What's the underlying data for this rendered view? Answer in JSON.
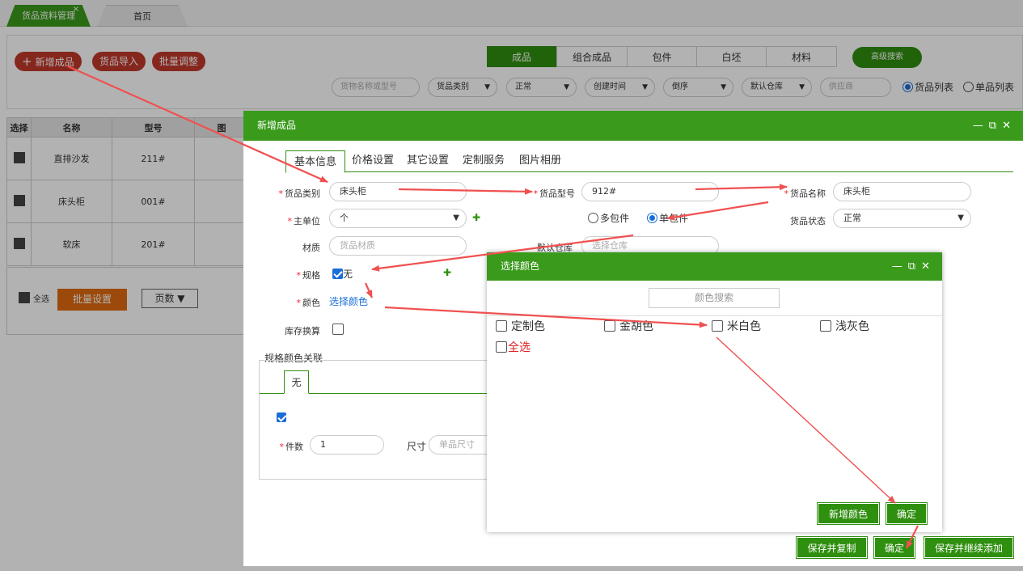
{
  "tabs": {
    "active": "货品资料管理",
    "close": "×",
    "home": "首页"
  },
  "toolbar": {
    "add": "新增成品",
    "import": "货品导入",
    "batch": "批量调整"
  },
  "segments": [
    "成品",
    "组合成品",
    "包件",
    "白坯",
    "材料"
  ],
  "advanced_search": "高级搜索",
  "filters": {
    "search_placeholder": "货物名称或型号",
    "category": "货品类别",
    "status": "正常",
    "sort_field": "创建时间",
    "order": "倒序",
    "warehouse": "默认仓库",
    "supplier_placeholder": "供应商",
    "view_goods": "货品列表",
    "view_single": "单品列表"
  },
  "table": {
    "headers": [
      "选择",
      "名称",
      "型号",
      "图"
    ],
    "rows": [
      {
        "name": "直排沙发",
        "model": "211#"
      },
      {
        "name": "床头柜",
        "model": "001#"
      },
      {
        "name": "软床",
        "model": "201#"
      }
    ],
    "select_all": "全选",
    "batch_setting": "批量设置",
    "pages": "页数 ▼"
  },
  "dialog": {
    "title": "新增成品",
    "tabs": [
      "基本信息",
      "价格设置",
      "其它设置",
      "定制服务",
      "图片相册"
    ],
    "category_label": "货品类别",
    "category_value": "床头柜",
    "model_label": "货品型号",
    "model_value": "912#",
    "name_label": "货品名称",
    "name_value": "床头柜",
    "unit_label": "主单位",
    "unit_value": "个",
    "pack_multi": "多包件",
    "pack_single": "单包件",
    "status_label": "货品状态",
    "status_value": "正常",
    "material_label": "材质",
    "material_placeholder": "货品材质",
    "warehouse_label": "默认仓库",
    "warehouse_placeholder": "选择仓库",
    "spec_label": "规格",
    "spec_value": "无",
    "color_label": "颜色",
    "color_link": "选择颜色",
    "stock_label": "库存换算",
    "relation_title": "规格颜色关联",
    "relation_tab": "无",
    "pieces_label": "件数",
    "pieces_value": "1",
    "size_label": "尺寸",
    "size_placeholder": "单品尺寸",
    "btn_save_copy": "保存并复制",
    "btn_ok": "确定",
    "btn_save_continue": "保存并继续添加"
  },
  "color_dialog": {
    "title": "选择颜色",
    "search_placeholder": "颜色搜索",
    "colors": [
      "定制色",
      "金胡色",
      "米白色",
      "浅灰色"
    ],
    "select_all": "全选",
    "btn_new": "新增颜色",
    "btn_ok": "确定"
  },
  "colors": {
    "green": "#3a9a1c",
    "red": "#c0392b",
    "arrow": "#f05050",
    "orange": "#e06a10"
  }
}
